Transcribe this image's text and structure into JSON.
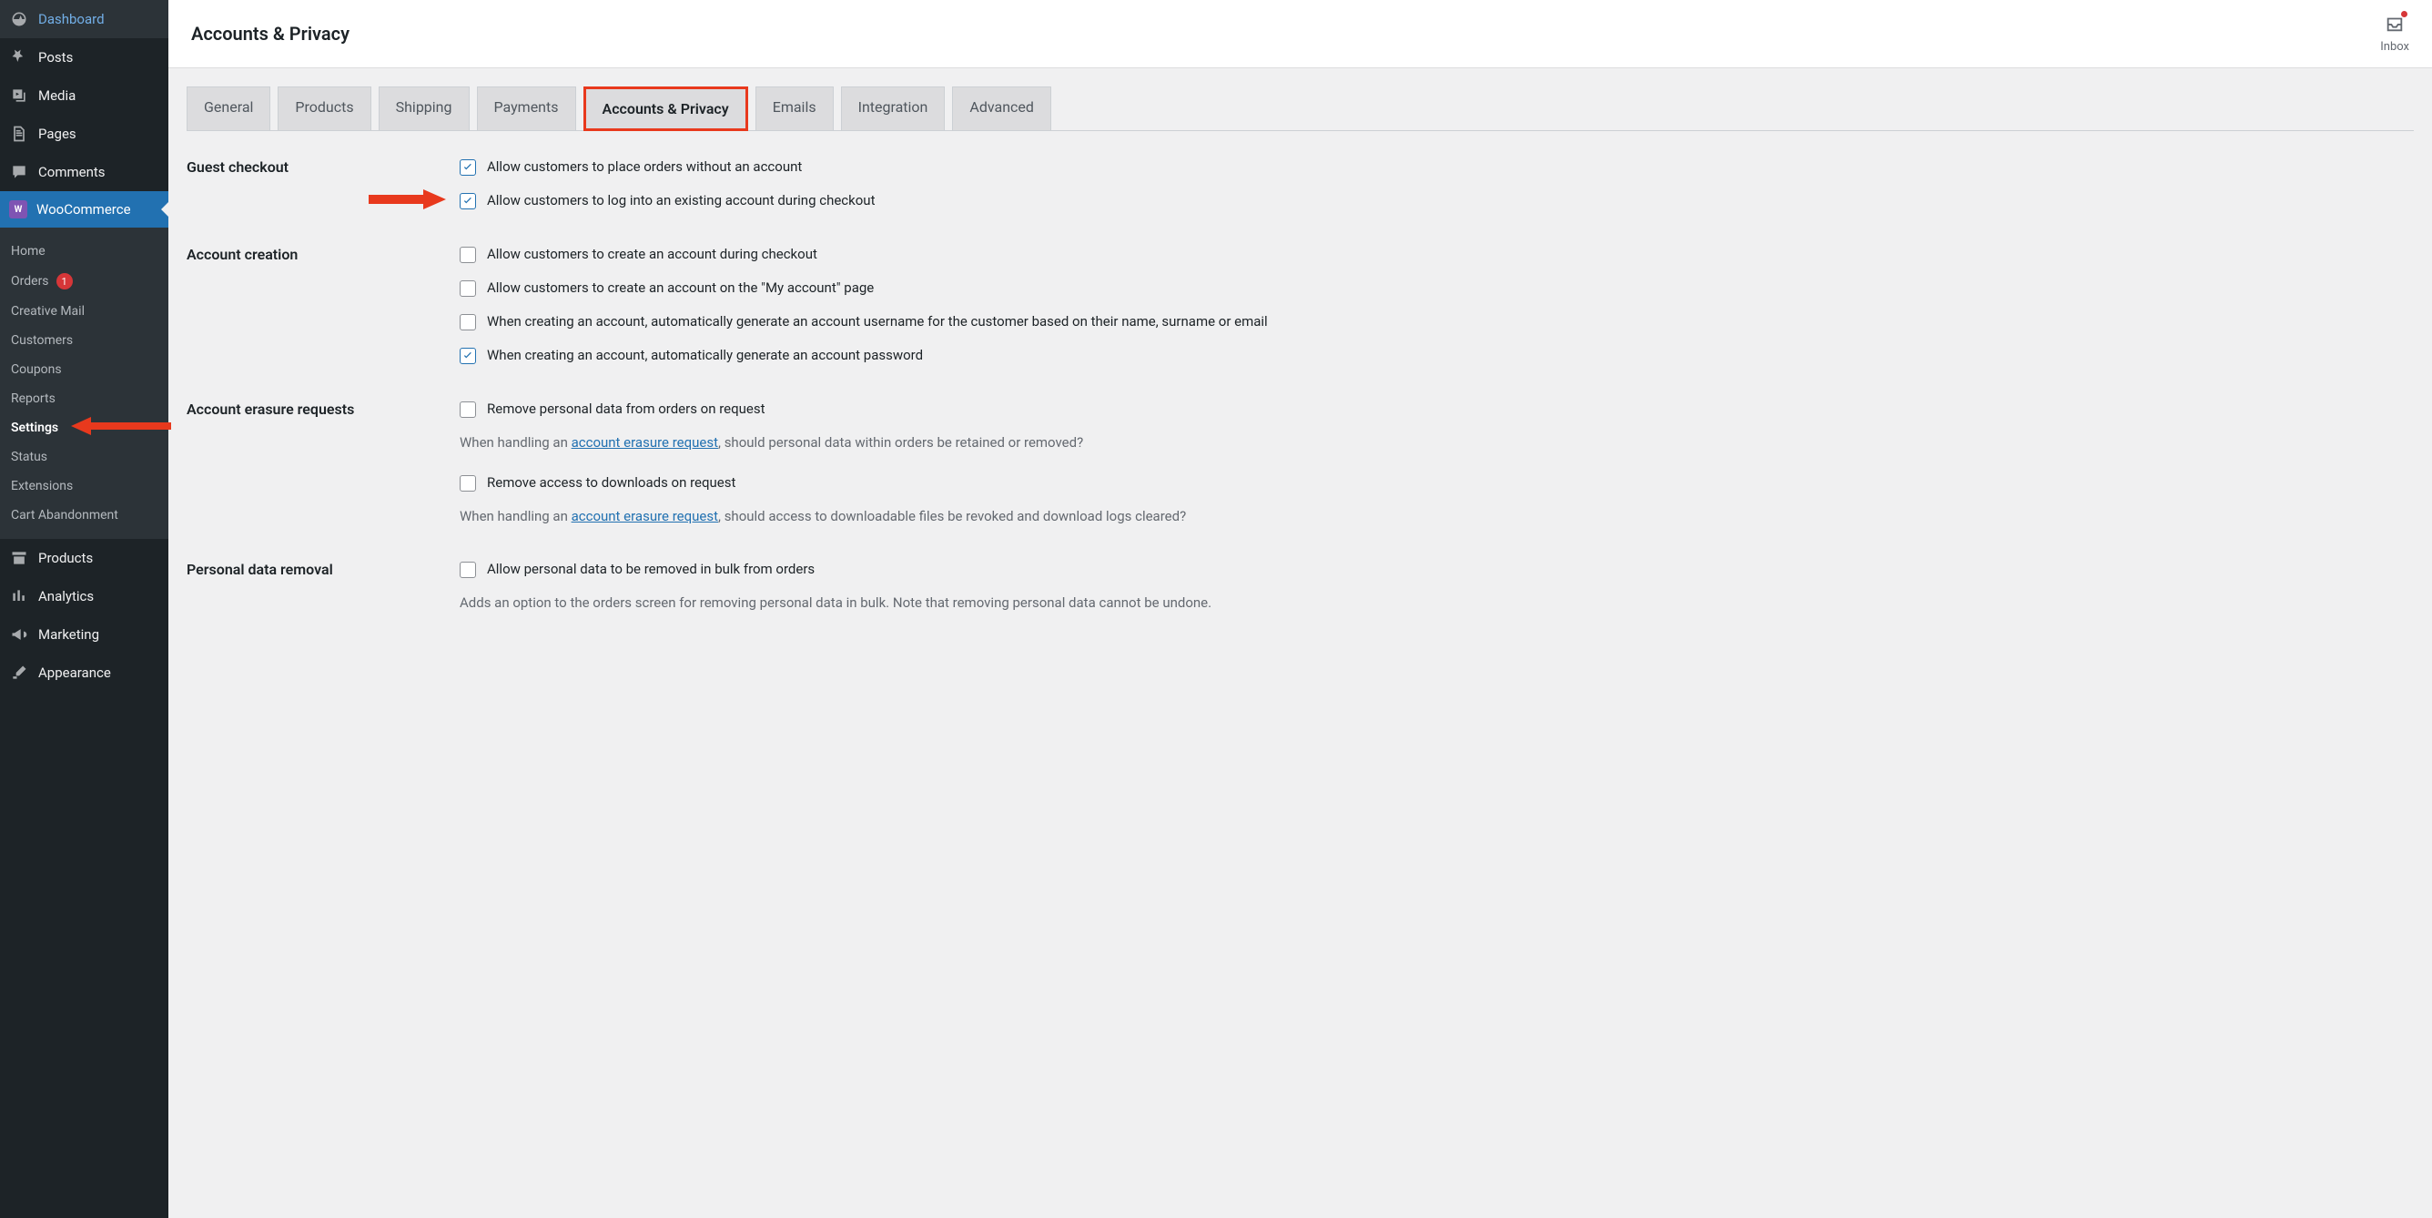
{
  "header": {
    "page_title": "Accounts & Privacy",
    "inbox_label": "Inbox"
  },
  "sidebar": {
    "items": [
      {
        "label": "Dashboard",
        "icon": "gauge"
      },
      {
        "label": "Posts",
        "icon": "pushpin"
      },
      {
        "label": "Media",
        "icon": "media"
      },
      {
        "label": "Pages",
        "icon": "page"
      },
      {
        "label": "Comments",
        "icon": "chat"
      },
      {
        "label": "WooCommerce",
        "icon": "woo",
        "active": true
      },
      {
        "label": "Products",
        "icon": "archive"
      },
      {
        "label": "Analytics",
        "icon": "bars"
      },
      {
        "label": "Marketing",
        "icon": "megaphone"
      },
      {
        "label": "Appearance",
        "icon": "brush"
      }
    ],
    "sub": {
      "items": [
        {
          "label": "Home"
        },
        {
          "label": "Orders",
          "badge": "1"
        },
        {
          "label": "Creative Mail"
        },
        {
          "label": "Customers"
        },
        {
          "label": "Coupons"
        },
        {
          "label": "Reports"
        },
        {
          "label": "Settings",
          "current": true
        },
        {
          "label": "Status"
        },
        {
          "label": "Extensions"
        },
        {
          "label": "Cart Abandonment"
        }
      ]
    }
  },
  "tabs": [
    {
      "label": "General"
    },
    {
      "label": "Products"
    },
    {
      "label": "Shipping"
    },
    {
      "label": "Payments"
    },
    {
      "label": "Accounts & Privacy",
      "active": true
    },
    {
      "label": "Emails"
    },
    {
      "label": "Integration"
    },
    {
      "label": "Advanced"
    }
  ],
  "sections": {
    "guest_checkout": {
      "label": "Guest checkout",
      "options": [
        {
          "label": "Allow customers to place orders without an account",
          "checked": true
        },
        {
          "label": "Allow customers to log into an existing account during checkout",
          "checked": true,
          "arrow": true
        }
      ]
    },
    "account_creation": {
      "label": "Account creation",
      "options": [
        {
          "label": "Allow customers to create an account during checkout",
          "checked": false
        },
        {
          "label": "Allow customers to create an account on the \"My account\" page",
          "checked": false
        },
        {
          "label": "When creating an account, automatically generate an account username for the customer based on their name, surname or email",
          "checked": false
        },
        {
          "label": "When creating an account, automatically generate an account password",
          "checked": true
        }
      ]
    },
    "erasure": {
      "label": "Account erasure requests",
      "options": [
        {
          "label": "Remove personal data from orders on request",
          "checked": false
        },
        {
          "label": "Remove access to downloads on request",
          "checked": false
        }
      ],
      "help1_pre": "When handling an ",
      "help1_link": "account erasure request",
      "help1_post": ", should personal data within orders be retained or removed?",
      "help2_pre": "When handling an ",
      "help2_link": "account erasure request",
      "help2_post": ", should access to downloadable files be revoked and download logs cleared?"
    },
    "removal": {
      "label": "Personal data removal",
      "options": [
        {
          "label": "Allow personal data to be removed in bulk from orders",
          "checked": false
        }
      ],
      "help": "Adds an option to the orders screen for removing personal data in bulk. Note that removing personal data cannot be undone."
    }
  }
}
